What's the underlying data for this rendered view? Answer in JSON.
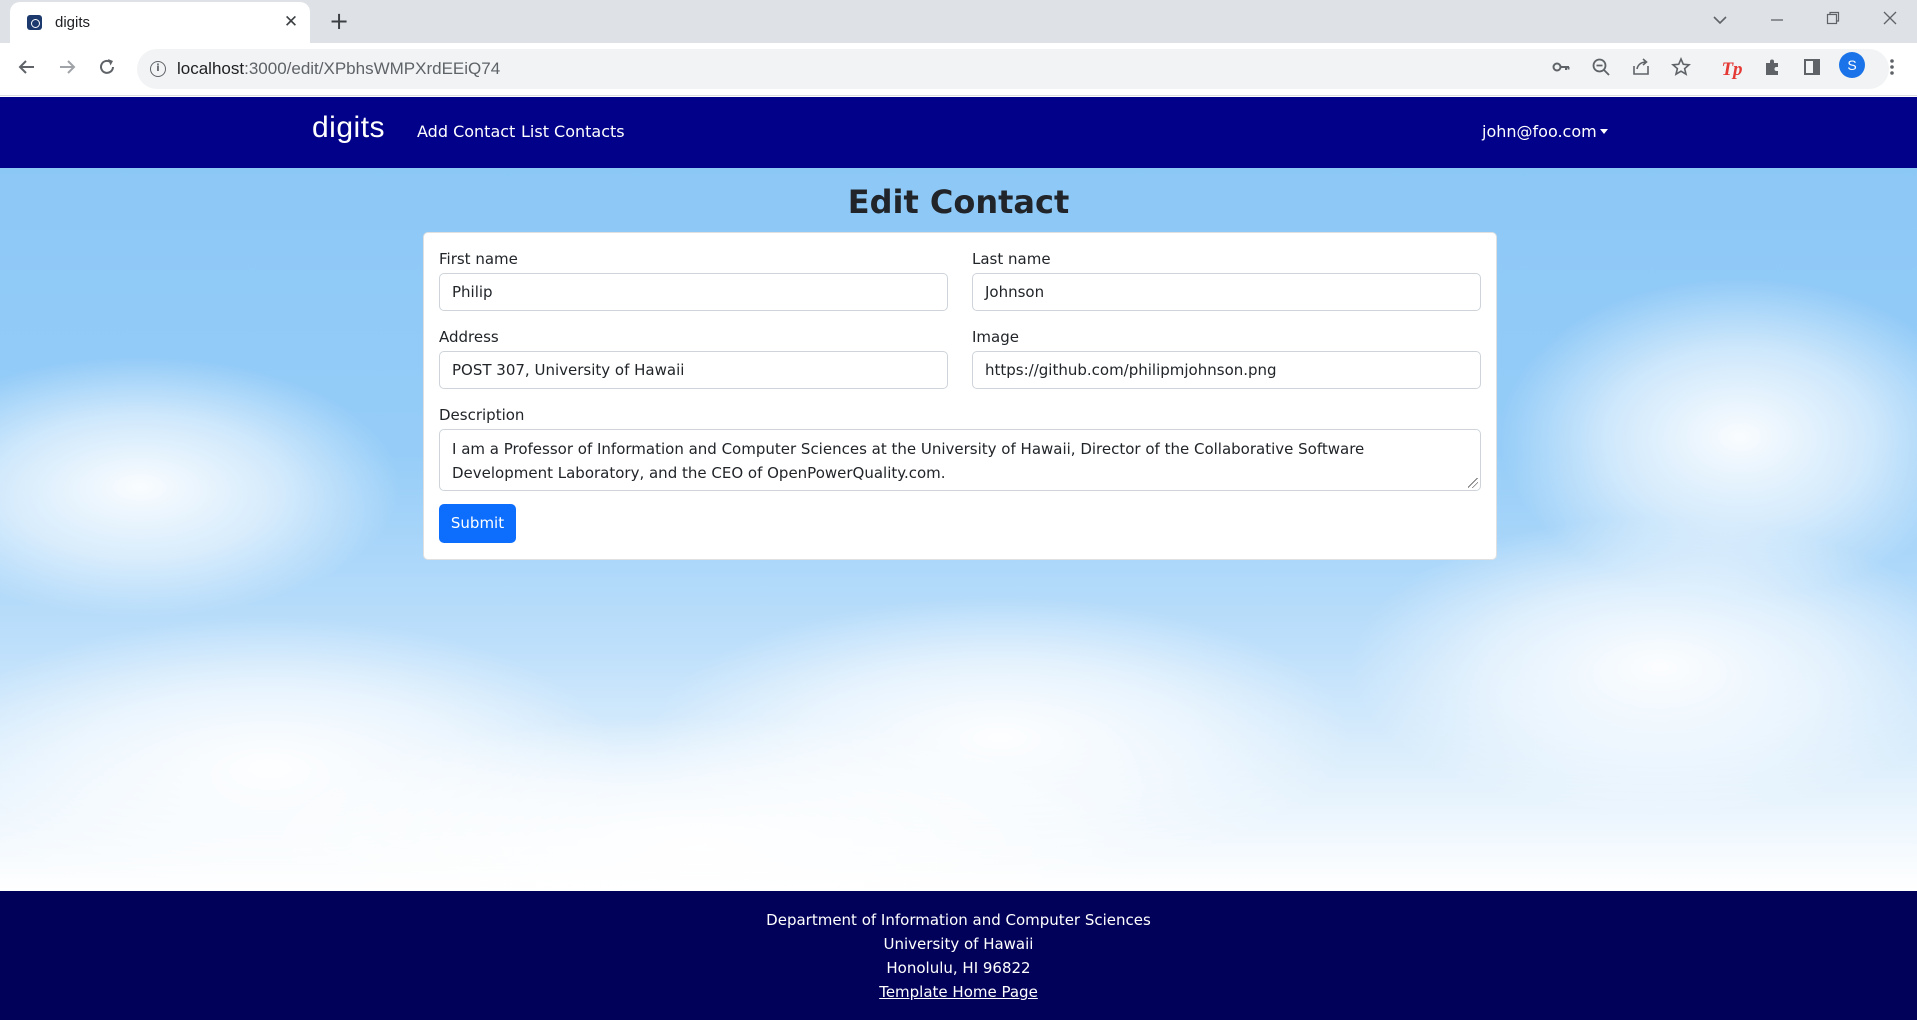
{
  "browser": {
    "tab_title": "digits",
    "tab_close": "✕",
    "new_tab": "+",
    "url_host": "localhost",
    "url_path": ":3000/edit/XPbhsWMPXrdEEiQ74",
    "profile_initial": "S",
    "tp_label": "Tp",
    "icons": [
      "back-icon",
      "forward-icon",
      "reload-icon",
      "info-icon",
      "key-icon",
      "zoom-out-icon",
      "share-icon",
      "star-icon",
      "tp-extension-icon",
      "puzzle-icon",
      "side-panel-icon",
      "menu-dots-icon"
    ]
  },
  "navbar": {
    "brand": "digits",
    "links": [
      "Add Contact",
      "List Contacts"
    ],
    "user": "john@foo.com",
    "background": "#010189"
  },
  "page": {
    "title": "Edit Contact"
  },
  "form": {
    "first_name_label": "First name",
    "first_name_value": "Philip",
    "last_name_label": "Last name",
    "last_name_value": "Johnson",
    "address_label": "Address",
    "address_value": "POST 307, University of Hawaii",
    "image_label": "Image",
    "image_value": "https://github.com/philipmjohnson.png",
    "description_label": "Description",
    "description_value": "I am a Professor of Information and Computer Sciences at the University of Hawaii, Director of the Collaborative Software Development Laboratory, and the CEO of OpenPowerQuality.com.",
    "submit_label": "Submit",
    "submit_color": "#0d6efd"
  },
  "footer": {
    "line1": "Department of Information and Computer Sciences",
    "line2": "University of Hawaii",
    "line3": "Honolulu, HI 96822",
    "link": "Template Home Page",
    "background": "#010159"
  }
}
